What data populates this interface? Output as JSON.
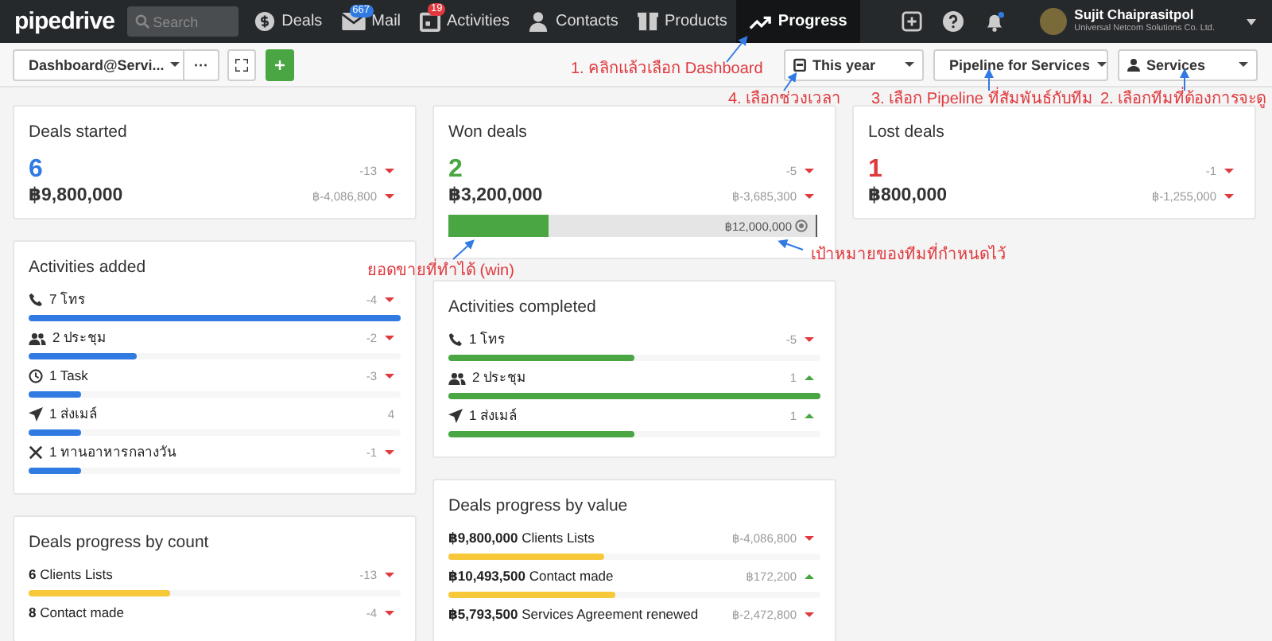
{
  "brand": "pipedrive",
  "search": {
    "placeholder": "Search"
  },
  "nav": [
    {
      "kind": "deals",
      "label": "Deals",
      "selected": false
    },
    {
      "kind": "mail",
      "label": "Mail",
      "badge": "667",
      "color": "#317ae2",
      "selected": false
    },
    {
      "kind": "activities",
      "label": "Activities",
      "badge": "19",
      "color": "#e0393e",
      "selected": false
    },
    {
      "kind": "contacts",
      "label": "Contacts",
      "selected": false
    },
    {
      "kind": "products",
      "label": "Products",
      "selected": false
    },
    {
      "kind": "progress",
      "label": "Progress",
      "selected": true
    }
  ],
  "user": {
    "name": "Sujit Chaiprasitpol",
    "company": "Universal Netcom Solutions Co. Ltd."
  },
  "toolbar": {
    "dashboard": "Dashboard@Servi...",
    "more": "···",
    "filters": [
      {
        "kind": "calendar",
        "label": "This year"
      },
      {
        "kind": "pipeline",
        "label": "Pipeline for Services"
      },
      {
        "kind": "person",
        "label": "Services"
      }
    ]
  },
  "columns": [
    [
      {
        "kind": "summary",
        "title": "Deals started",
        "count": "6",
        "color": "#317ae2",
        "count_change": {
          "text": "-13",
          "kind": "down"
        },
        "value": "฿9,800,000",
        "value_change": {
          "text": "฿-4,086,800",
          "kind": "down"
        }
      },
      {
        "kind": "bars",
        "title": "Activities added",
        "color": "#317ae2",
        "rows": [
          {
            "kind": "phone",
            "label": "7 โทร",
            "change": {
              "text": "-4",
              "kind": "down"
            },
            "level": 1
          },
          {
            "kind": "people",
            "label": "2 ประชุม",
            "change": {
              "text": "-2",
              "kind": "down"
            },
            "level": 0.29
          },
          {
            "kind": "clock",
            "label": "1 Task",
            "change": {
              "text": "-3",
              "kind": "down"
            },
            "level": 0.14
          },
          {
            "kind": "send",
            "label": "1 ส่งเมล์",
            "change": {
              "text": "4"
            },
            "level": 0.14
          },
          {
            "kind": "cutlery",
            "label": "1 ทานอาหารกลางวัน",
            "change": {
              "text": "-1",
              "kind": "down"
            },
            "level": 0.14
          }
        ]
      },
      {
        "kind": "bars",
        "title": "Deals progress by count",
        "color": "#f7c83a",
        "rows": [
          {
            "label": "**6** Clients Lists",
            "change": {
              "text": "-13",
              "kind": "down"
            },
            "level": 0.38
          },
          {
            "label": "**8** Contact made",
            "change": {
              "text": "-4",
              "kind": "down"
            }
          }
        ]
      }
    ],
    [
      {
        "kind": "summary",
        "title": "Won deals",
        "count": "2",
        "color": "#4aa543",
        "count_change": {
          "text": "-5",
          "kind": "down"
        },
        "value": "฿3,200,000",
        "value_change": {
          "text": "฿-3,685,300",
          "kind": "down"
        },
        "goal": {
          "text": "฿12,000,000",
          "level": 0.27
        }
      },
      {
        "kind": "bars",
        "title": "Activities completed",
        "color": "#4aa543",
        "rows": [
          {
            "kind": "phone",
            "label": "1 โทร",
            "change": {
              "text": "-5",
              "kind": "down"
            },
            "level": 0.5
          },
          {
            "kind": "people",
            "label": "2 ประชุม",
            "change": {
              "text": "1",
              "kind": "up"
            },
            "level": 1
          },
          {
            "kind": "send",
            "label": "1 ส่งเมล์",
            "change": {
              "text": "1",
              "kind": "up"
            },
            "level": 0.5
          }
        ]
      },
      {
        "kind": "bars",
        "title": "Deals progress by value",
        "color": "#f7c83a",
        "rows": [
          {
            "label": "**฿9,800,000** Clients Lists",
            "change": {
              "text": "฿-4,086,800",
              "kind": "down"
            },
            "level": 0.42
          },
          {
            "label": "**฿10,493,500** Contact made",
            "change": {
              "text": "฿172,200",
              "kind": "up"
            },
            "level": 0.45
          },
          {
            "label": "**฿5,793,500** Services Agreement renewed",
            "change": {
              "text": "฿-2,472,800",
              "kind": "down"
            }
          }
        ]
      }
    ],
    [
      {
        "kind": "summary",
        "title": "Lost deals",
        "count": "1",
        "color": "#e0393e",
        "count_change": {
          "text": "-1",
          "kind": "down"
        },
        "value": "฿800,000",
        "value_change": {
          "text": "฿-1,255,000",
          "kind": "down"
        }
      }
    ]
  ],
  "annotations": [
    {
      "text": "1. คลิกแล้วเลือก Dashboard"
    },
    {
      "text": "4. เลือกช่วงเวลา"
    },
    {
      "text": "3. เลือก Pipeline ที่สัมพันธ์กับทีม"
    },
    {
      "text": "2. เลือกทีมที่ต้องการจะดู"
    },
    {
      "text": "ยอดขายที่ทำได้ (win)"
    },
    {
      "text": "เป้าหมายของทีมที่กำหนดไว้"
    }
  ]
}
